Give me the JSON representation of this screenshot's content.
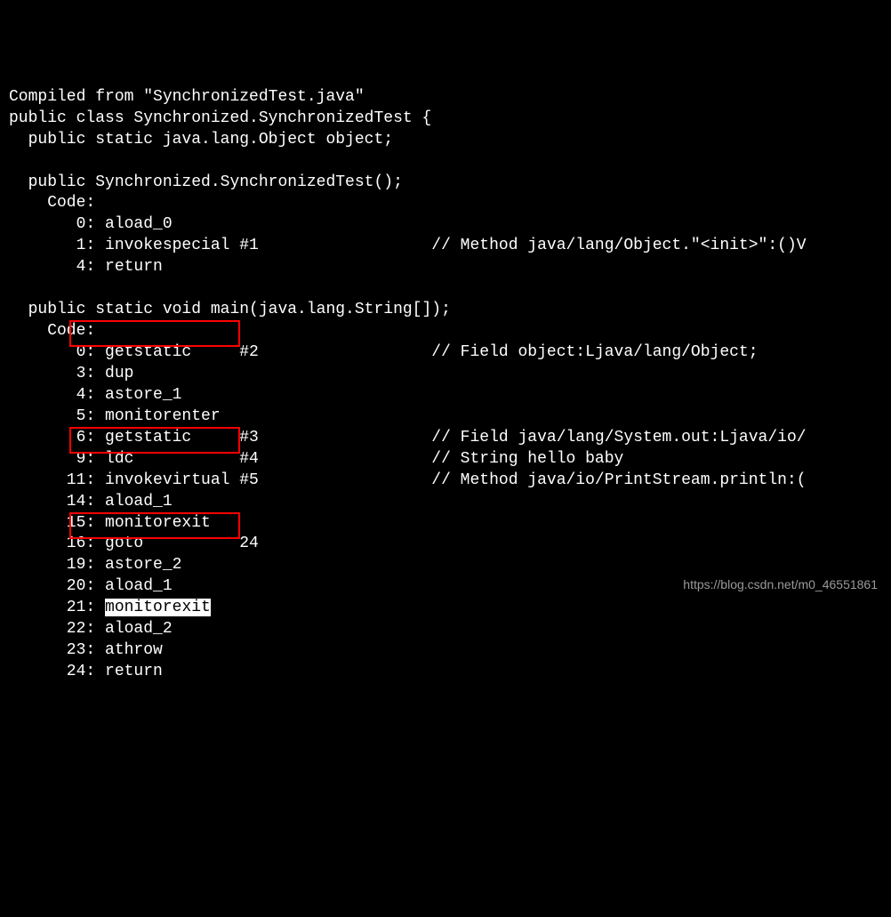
{
  "watermark": "https://blog.csdn.net/m0_46551861",
  "lines": [
    "Compiled from \"SynchronizedTest.java\"",
    "public class Synchronized.SynchronizedTest {",
    "  public static java.lang.Object object;",
    "",
    "  public Synchronized.SynchronizedTest();",
    "    Code:",
    "       0: aload_0",
    "       1: invokespecial #1                  // Method java/lang/Object.\"<init>\":()V",
    "       4: return",
    "",
    "  public static void main(java.lang.String[]);",
    "    Code:",
    "       0: getstatic     #2                  // Field object:Ljava/lang/Object;",
    "       3: dup",
    "       4: astore_1",
    "       5: monitorenter",
    "       6: getstatic     #3                  // Field java/lang/System.out:Ljava/io/",
    "       9: ldc           #4                  // String hello baby",
    "      11: invokevirtual #5                  // Method java/io/PrintStream.println:(",
    "      14: aload_1",
    "      15: monitorexit",
    "      16: goto          24",
    "      19: astore_2",
    "      20: aload_1"
  ],
  "line_highlight_prefix": "      21: ",
  "line_highlight_text": "monitorexit",
  "lines_after": [
    "      22: aload_2",
    "      23: athrow",
    "      24: return"
  ]
}
